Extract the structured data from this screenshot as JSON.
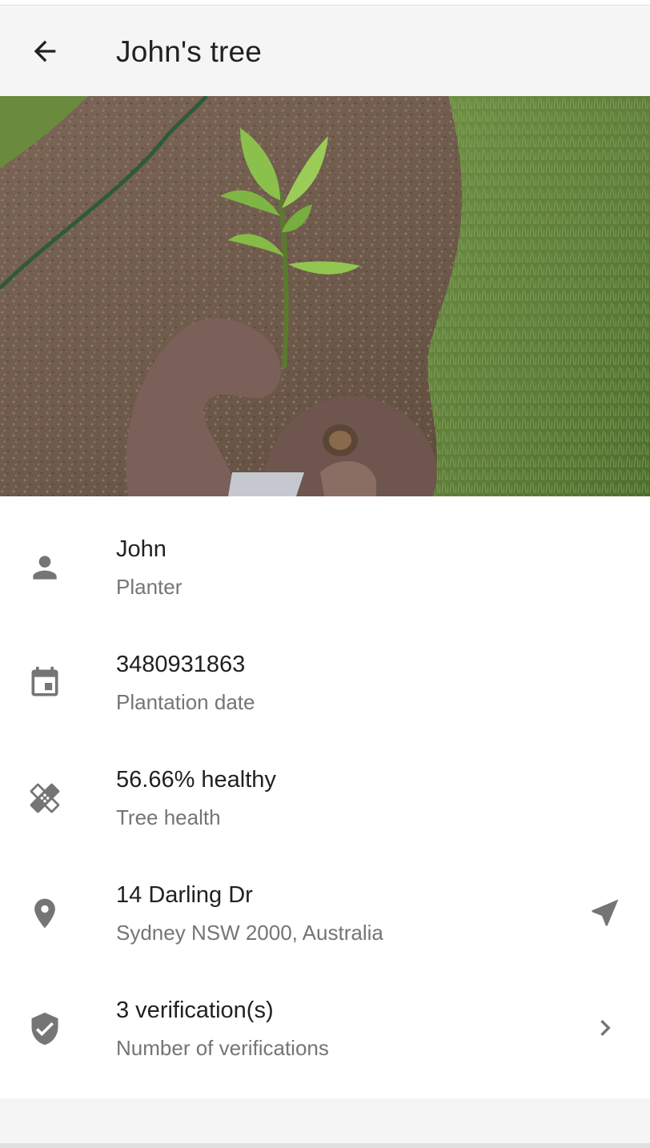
{
  "appbar": {
    "title": "John's tree",
    "back_icon": "arrow-back-icon"
  },
  "photo": {
    "subject": "tree-sapling-photo"
  },
  "details": [
    {
      "icon": "person-icon",
      "primary": "John",
      "secondary": "Planter"
    },
    {
      "icon": "calendar-icon",
      "primary": "3480931863",
      "secondary": "Plantation date"
    },
    {
      "icon": "healing-icon",
      "primary": "56.66% healthy",
      "secondary": "Tree health"
    },
    {
      "icon": "location-pin-icon",
      "primary": "14 Darling Dr",
      "secondary": "Sydney NSW 2000, Australia",
      "action_icon": "navigation-arrow-icon"
    },
    {
      "icon": "verified-shield-icon",
      "primary": "3 verification(s)",
      "secondary": "Number of verifications",
      "action_icon": "chevron-right-icon"
    }
  ],
  "colors": {
    "appbar_bg": "#f5f5f5",
    "icon_grey": "#757575",
    "primary_text": "#212121",
    "secondary_text": "#757575"
  }
}
